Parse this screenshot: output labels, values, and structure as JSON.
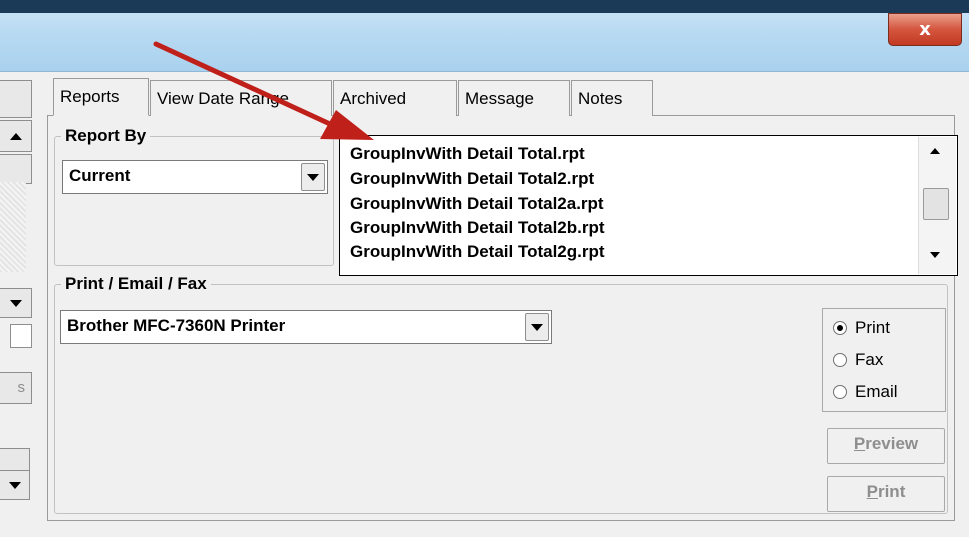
{
  "window": {
    "close_label": "x"
  },
  "left_panel": {
    "partial_button_label": "s"
  },
  "tabs": [
    {
      "label": "Reports"
    },
    {
      "label": "View Date Range"
    },
    {
      "label": "Archived"
    },
    {
      "label": "Message"
    },
    {
      "label": "Notes"
    }
  ],
  "report_by": {
    "legend": "Report By",
    "selected": "Current"
  },
  "report_files": [
    "GroupInvWith Detail Total.rpt",
    "GroupInvWith Detail Total2.rpt",
    "GroupInvWith Detail Total2a.rpt",
    "GroupInvWith Detail Total2b.rpt",
    "GroupInvWith Detail Total2g.rpt"
  ],
  "output": {
    "legend": "Print / Email / Fax",
    "printer": "Brother MFC-7360N Printer",
    "options": [
      {
        "label": "Print",
        "selected": true
      },
      {
        "label": "Fax",
        "selected": false
      },
      {
        "label": "Email",
        "selected": false
      }
    ]
  },
  "buttons": {
    "preview_mnemonic": "P",
    "preview_rest": "review",
    "print_mnemonic": "P",
    "print_rest": "rint"
  },
  "annotation": {
    "arrow_color": "#c0201a"
  }
}
